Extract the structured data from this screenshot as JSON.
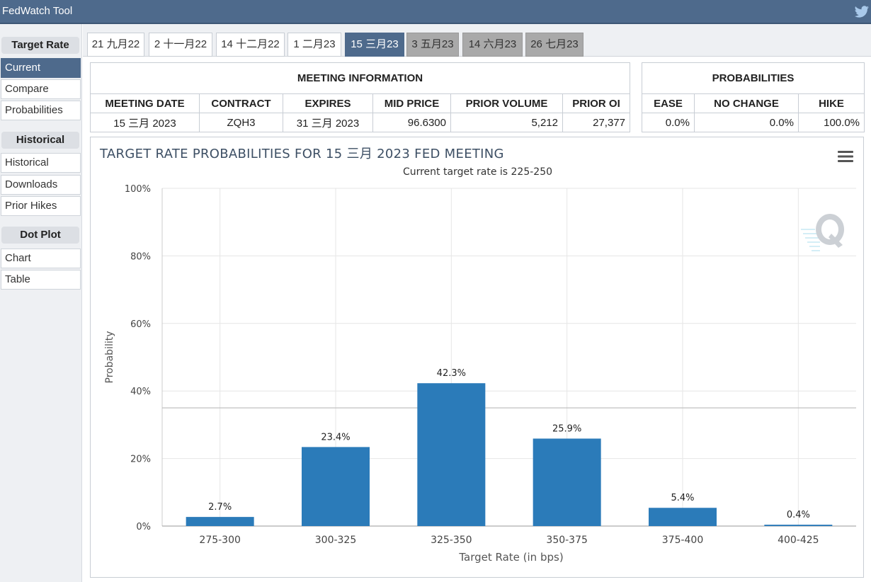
{
  "app": {
    "title": "FedWatch Tool"
  },
  "sidebar": {
    "sections": [
      {
        "heading": "Target Rate",
        "items": [
          "Current",
          "Compare",
          "Probabilities"
        ]
      },
      {
        "heading": "Historical",
        "items": [
          "Historical",
          "Downloads",
          "Prior Hikes"
        ]
      },
      {
        "heading": "Dot Plot",
        "items": [
          "Chart",
          "Table"
        ]
      }
    ],
    "active_item": "Current"
  },
  "tabs": [
    {
      "label": "21 九月22",
      "state": "normal"
    },
    {
      "label": "2 十一月22",
      "state": "normal"
    },
    {
      "label": "14 十二月22",
      "state": "normal"
    },
    {
      "label": "1 二月23",
      "state": "normal"
    },
    {
      "label": "15 三月23",
      "state": "active"
    },
    {
      "label": "3 五月23",
      "state": "future"
    },
    {
      "label": "14 六月23",
      "state": "future"
    },
    {
      "label": "26 七月23",
      "state": "future"
    }
  ],
  "meeting_info": {
    "heading": "MEETING INFORMATION",
    "columns": [
      "MEETING DATE",
      "CONTRACT",
      "EXPIRES",
      "MID PRICE",
      "PRIOR VOLUME",
      "PRIOR OI"
    ],
    "row": [
      "15 三月 2023",
      "ZQH3",
      "31 三月 2023",
      "96.6300",
      "5,212",
      "27,377"
    ]
  },
  "probabilities": {
    "heading": "PROBABILITIES",
    "columns": [
      "EASE",
      "NO CHANGE",
      "HIKE"
    ],
    "row": [
      "0.0%",
      "0.0%",
      "100.0%"
    ]
  },
  "colors": {
    "bar": "#2b7bb9",
    "header": "#4e6a8c",
    "future_tab": "#a9a9a9"
  },
  "chart_data": {
    "type": "bar",
    "title": "TARGET RATE PROBABILITIES FOR 15 三月 2023 FED MEETING",
    "subtitle": "Current target rate is 225-250",
    "xlabel": "Target Rate (in bps)",
    "ylabel": "Probability",
    "categories": [
      "275-300",
      "300-325",
      "325-350",
      "350-375",
      "375-400",
      "400-425"
    ],
    "values": [
      2.7,
      23.4,
      42.3,
      25.9,
      5.4,
      0.4
    ],
    "value_labels": [
      "2.7%",
      "23.4%",
      "42.3%",
      "25.9%",
      "5.4%",
      "0.4%"
    ],
    "ylim": [
      0,
      100
    ],
    "yticks": [
      0,
      20,
      40,
      60,
      80,
      100
    ],
    "ytick_labels": [
      "0%",
      "20%",
      "40%",
      "60%",
      "80%",
      "100%"
    ],
    "reference_line": 35,
    "grid": true,
    "legend": "none"
  }
}
